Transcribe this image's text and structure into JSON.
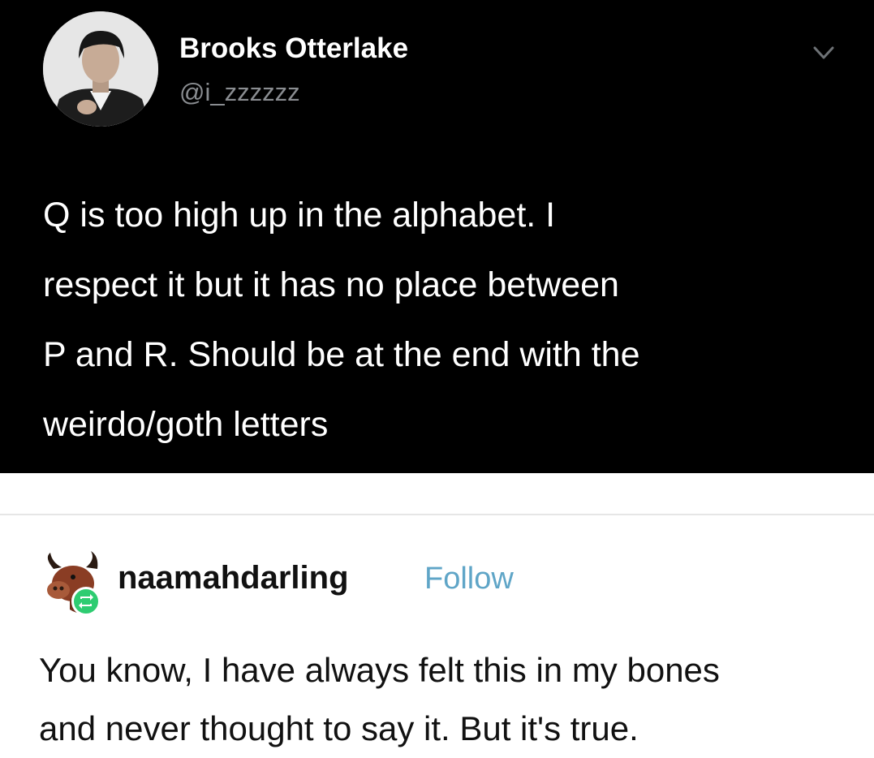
{
  "tweet": {
    "display_name": "Brooks Otterlake",
    "handle": "@i_zzzzzz",
    "text_lines": [
      "Q is too high up in the alphabet. I",
      "respect it but it has no place between",
      "P and R. Should be at the end with the",
      "weirdo/goth letters"
    ],
    "avatar_icon": "profile-photo",
    "menu_icon": "chevron-down-icon"
  },
  "reblog": {
    "username": "naamahdarling",
    "follow_label": "Follow",
    "text_lines": [
      "You know, I have always felt this in my bones",
      "and never thought to say it. But it's true."
    ],
    "avatar_icon": "bull-avatar",
    "badge_icon": "reblog-icon",
    "follow_color": "#5fa5c7",
    "badge_color": "#2ecc71"
  }
}
